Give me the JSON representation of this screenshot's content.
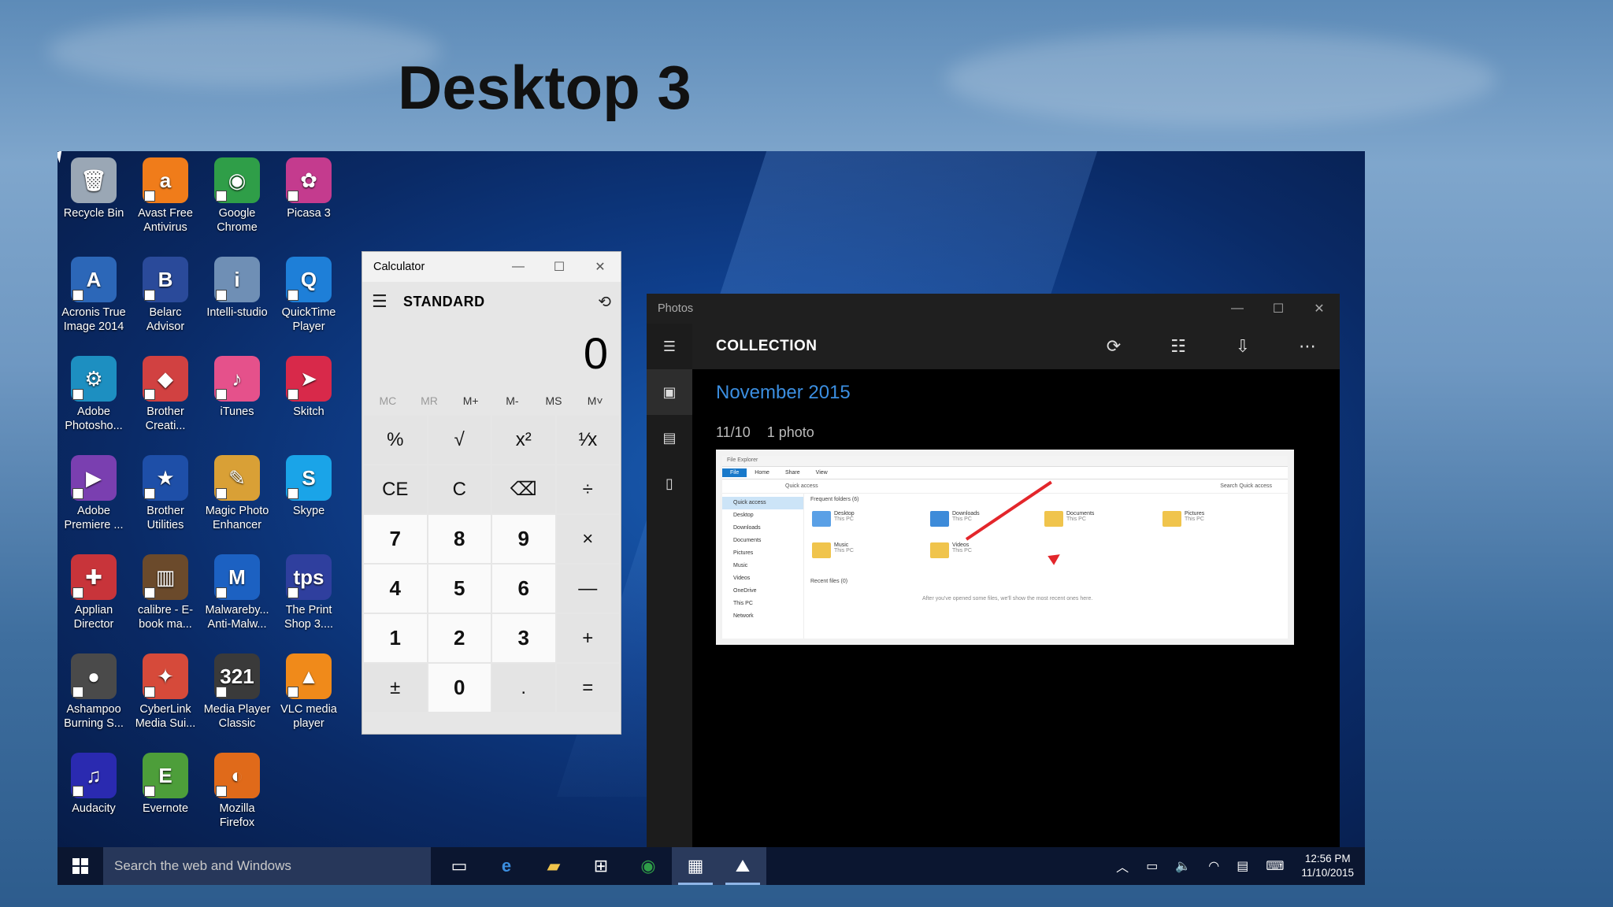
{
  "slide": {
    "title": "Desktop 3"
  },
  "desktop_icons": [
    {
      "label": "Recycle Bin",
      "color": "#9aa7b5",
      "glyph": "🗑"
    },
    {
      "label": "Avast Free Antivirus",
      "color": "#f07c1a",
      "glyph": "a"
    },
    {
      "label": "Google Chrome",
      "color": "#2f9e48",
      "glyph": "◉"
    },
    {
      "label": "Picasa 3",
      "color": "#c43b8e",
      "glyph": "✿"
    },
    {
      "label": "Acronis True Image 2014",
      "color": "#2c67b8",
      "glyph": "A"
    },
    {
      "label": "Belarc Advisor",
      "color": "#2a4a9a",
      "glyph": "B"
    },
    {
      "label": "Intelli-studio",
      "color": "#6f8fb5",
      "glyph": "i"
    },
    {
      "label": "QuickTime Player",
      "color": "#1e7fd8",
      "glyph": "Q"
    },
    {
      "label": "Adobe Photosho...",
      "color": "#1d8fc1",
      "glyph": "⚙"
    },
    {
      "label": "Brother Creati...",
      "color": "#d14141",
      "glyph": "◆"
    },
    {
      "label": "iTunes",
      "color": "#e5518b",
      "glyph": "♪"
    },
    {
      "label": "Skitch",
      "color": "#d8294a",
      "glyph": "➤"
    },
    {
      "label": "Adobe Premiere ...",
      "color": "#7a3fb0",
      "glyph": "▶"
    },
    {
      "label": "Brother Utilities",
      "color": "#1e4fa8",
      "glyph": "★"
    },
    {
      "label": "Magic Photo Enhancer",
      "color": "#d9a036",
      "glyph": "✎"
    },
    {
      "label": "Skype",
      "color": "#1aa4e8",
      "glyph": "S"
    },
    {
      "label": "Applian Director",
      "color": "#c8343a",
      "glyph": "✚"
    },
    {
      "label": "calibre - E-book ma...",
      "color": "#6b4a2b",
      "glyph": "▥"
    },
    {
      "label": "Malwareby... Anti-Malw...",
      "color": "#1c61c2",
      "glyph": "M"
    },
    {
      "label": "The Print Shop 3....",
      "color": "#2f3f9e",
      "glyph": "tps"
    },
    {
      "label": "Ashampoo Burning S...",
      "color": "#4a4a4a",
      "glyph": "●"
    },
    {
      "label": "CyberLink Media Sui...",
      "color": "#d64a3a",
      "glyph": "✦"
    },
    {
      "label": "Media Player Classic",
      "color": "#3a3a3a",
      "glyph": "321"
    },
    {
      "label": "VLC media player",
      "color": "#f08a1a",
      "glyph": "▲"
    },
    {
      "label": "Audacity",
      "color": "#2a2ab0",
      "glyph": "♫"
    },
    {
      "label": "Evernote",
      "color": "#4d9e3a",
      "glyph": "E"
    },
    {
      "label": "Mozilla Firefox",
      "color": "#e06a1a",
      "glyph": "◐"
    }
  ],
  "calculator": {
    "window_title": "Calculator",
    "mode": "STANDARD",
    "display": "0",
    "memory": [
      "MC",
      "MR",
      "M+",
      "M-",
      "MS",
      "M˅"
    ],
    "keys": [
      "%",
      "√",
      "x²",
      "¹⁄x",
      "CE",
      "C",
      "⌫",
      "÷",
      "7",
      "8",
      "9",
      "×",
      "4",
      "5",
      "6",
      "—",
      "1",
      "2",
      "3",
      "+",
      "±",
      "0",
      ".",
      "="
    ]
  },
  "photos": {
    "window_title": "Photos",
    "header": "COLLECTION",
    "month": "November 2015",
    "date": "11/10",
    "count": "1 photo",
    "thumbnail": {
      "window_title": "File Explorer",
      "ribbon": [
        "File",
        "Home",
        "Share",
        "View"
      ],
      "address": "Quick access",
      "search": "Search Quick access",
      "nav": [
        "Quick access",
        "Desktop",
        "Downloads",
        "Documents",
        "Pictures",
        "Music",
        "Videos",
        "OneDrive",
        "This PC",
        "Network"
      ],
      "frequent_header": "Frequent folders (6)",
      "folders": [
        {
          "name": "Desktop",
          "sub": "This PC"
        },
        {
          "name": "Downloads",
          "sub": "This PC"
        },
        {
          "name": "Documents",
          "sub": "This PC"
        },
        {
          "name": "Pictures",
          "sub": "This PC"
        },
        {
          "name": "Music",
          "sub": "This PC"
        },
        {
          "name": "Videos",
          "sub": "This PC"
        }
      ],
      "recent_header": "Recent files (0)",
      "recent_empty": "After you've opened some files, we'll show the most recent ones here."
    }
  },
  "taskbar": {
    "search_placeholder": "Search the web and Windows",
    "time": "12:56 PM",
    "date": "11/10/2015"
  }
}
